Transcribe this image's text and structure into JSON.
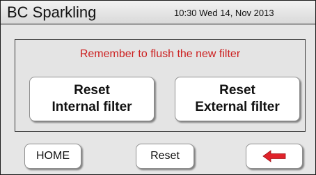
{
  "header": {
    "title": "BC Sparkling",
    "datetime": "10:30 Wed 14, Nov 2013"
  },
  "panel": {
    "notice": "Remember to flush the new filter",
    "notice_color": "#cc1f1f",
    "reset_internal": {
      "line1": "Reset",
      "line2": "Internal filter"
    },
    "reset_external": {
      "line1": "Reset",
      "line2": "External filter"
    }
  },
  "footer": {
    "home_label": "HOME",
    "reset_label": "Reset",
    "back_icon": "red-left-arrow-icon",
    "back_icon_color": "#e0222a"
  }
}
